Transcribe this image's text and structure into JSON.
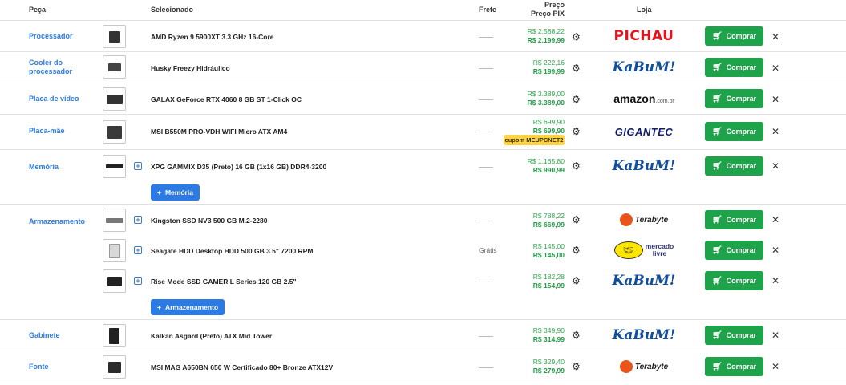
{
  "header": {
    "peca": "Peça",
    "selecionado": "Selecionado",
    "frete": "Frete",
    "preco": "Preço",
    "preco_pix": "Preço PIX",
    "loja": "Loja"
  },
  "labels": {
    "buy": "Comprar",
    "add_memoria": "Memória",
    "add_armazenamento": "Armazenamento",
    "frete_gratis": "Grátis",
    "coupon": "cupom MEUPCNET2"
  },
  "colors": {
    "accent_blue": "#2c7be5",
    "buy_green": "#1ea34b",
    "price_green": "#2fa84f",
    "coupon_yellow": "#ffd23f"
  },
  "rows": [
    {
      "category": "Processador",
      "product": "AMD Ryzen 9 5900XT 3.3 GHz 16-Core",
      "price": "R$ 2.588,22",
      "price_pix": "R$ 2.199,99",
      "store": "Pichau",
      "frete": "—"
    },
    {
      "category": "Cooler do processador",
      "product": "Husky Freezy Hidráulico",
      "price": "R$ 222,16",
      "price_pix": "R$ 199,99",
      "store": "KaBuM!",
      "frete": "—"
    },
    {
      "category": "Placa de vídeo",
      "product": "GALAX GeForce RTX 4060 8 GB ST 1-Click OC",
      "price": "R$ 3.389,00",
      "price_pix": "R$ 3.389,00",
      "store": "amazon.com.br",
      "frete": "—"
    },
    {
      "category": "Placa-mãe",
      "product": "MSI B550M PRO-VDH WIFI Micro ATX AM4",
      "price": "R$ 699,90",
      "price_pix": "R$ 699,90",
      "store": "GIGANTEC",
      "frete": "—"
    },
    {
      "category": "Memória",
      "product": "XPG GAMMIX D35 (Preto) 16 GB (1x16 GB) DDR4-3200",
      "price": "R$ 1.165,80",
      "price_pix": "R$ 990,99",
      "store": "KaBuM!",
      "frete": "—"
    },
    {
      "category": "Armazenamento",
      "product": "Kingston SSD NV3 500 GB M.2-2280",
      "price": "R$ 788,22",
      "price_pix": "R$ 669,99",
      "store": "Terabyte",
      "frete": "—"
    },
    {
      "category": "",
      "product": "Seagate HDD Desktop HDD 500 GB 3.5\" 7200 RPM",
      "price": "R$ 145,00",
      "price_pix": "R$ 145,00",
      "store": "Mercado Livre",
      "frete": "Grátis"
    },
    {
      "category": "",
      "product": "Rise Mode SSD GAMER L Series 120 GB 2.5\"",
      "price": "R$ 182,28",
      "price_pix": "R$ 154,99",
      "store": "KaBuM!",
      "frete": "—"
    },
    {
      "category": "Gabinete",
      "product": "Kalkan Asgard (Preto) ATX Mid Tower",
      "price": "R$ 349,90",
      "price_pix": "R$ 314,99",
      "store": "KaBuM!",
      "frete": "—"
    },
    {
      "category": "Fonte",
      "product": "MSI MAG A650BN 650 W Certificado 80+ Bronze ATX12V",
      "price": "R$ 329,40",
      "price_pix": "R$ 279,99",
      "store": "Terabyte",
      "frete": "—"
    }
  ],
  "logos": {
    "pichau": "PICHAU",
    "kabum": "KaBuM!",
    "amazon": "amazon",
    "amazon_suffix": ".com.br",
    "gigantec": "GIGANTEC",
    "terabyte": "Terabyte",
    "ml_top": "mercado",
    "ml_bottom": "livre"
  },
  "icons": {
    "settings": "gear-icon",
    "remove": "close-icon",
    "cart": "cart-icon",
    "add": "plus-icon"
  }
}
